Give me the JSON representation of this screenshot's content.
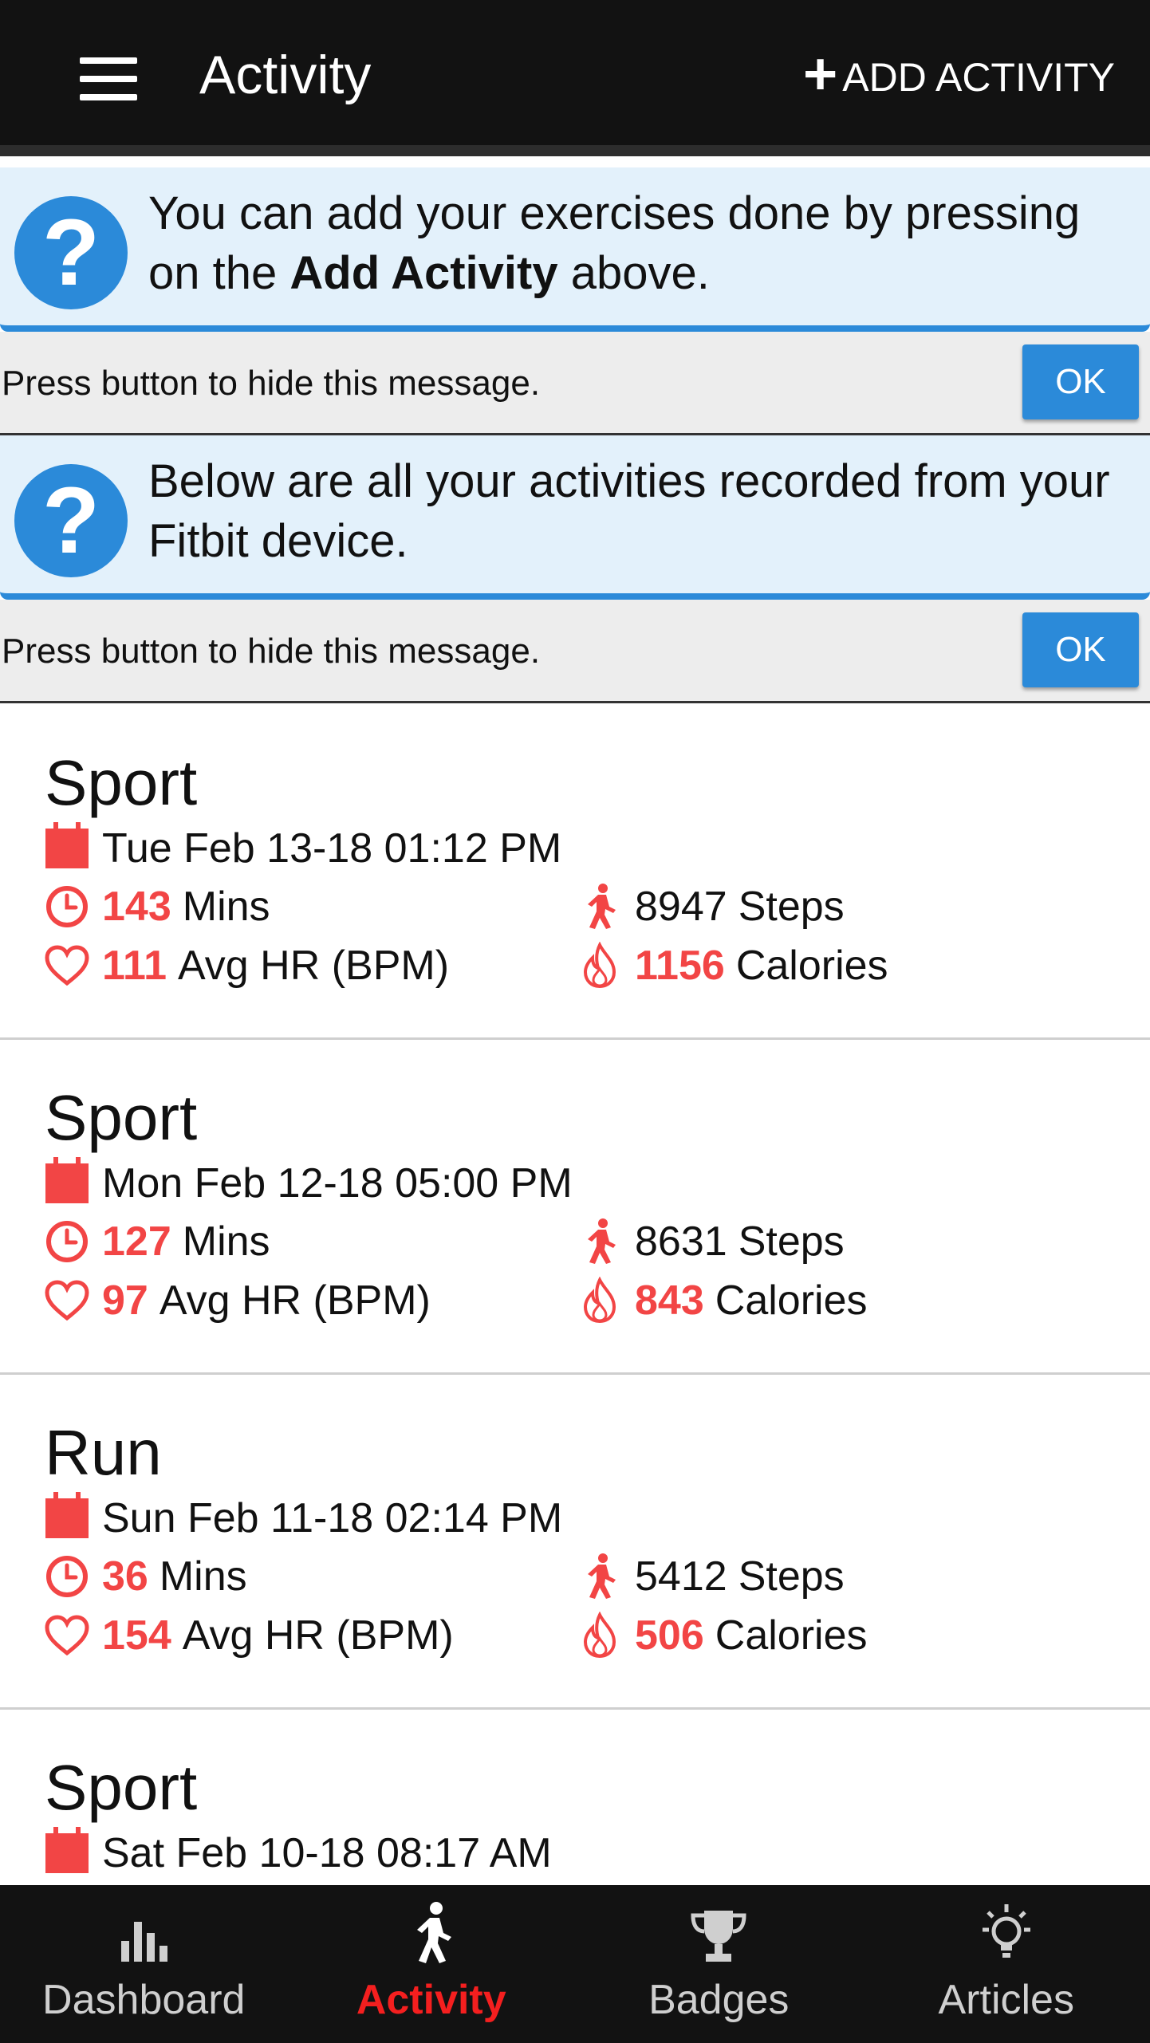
{
  "header": {
    "title": "Activity",
    "add_label": "ADD ACTIVITY",
    "add_icon": "plus-icon",
    "menu_icon": "hamburger-menu-icon"
  },
  "notices": [
    {
      "text_before": "You can add your exercises done by pressing on the ",
      "text_bold": "Add Activity",
      "text_after": " above.",
      "hint": "Press button to hide this message.",
      "button": "OK"
    },
    {
      "text_before": "Below are all your activities recorded from your Fitbit device.",
      "text_bold": "",
      "text_after": "",
      "hint": "Press button to hide this message.",
      "button": "OK"
    }
  ],
  "labels": {
    "mins": "Mins",
    "hr": "Avg HR (BPM)",
    "steps": "Steps",
    "calories": "Calories"
  },
  "activities": [
    {
      "name": "Sport",
      "date": "Tue Feb 13-18 01:12 PM",
      "mins": "143",
      "steps": "8947",
      "hr": "111",
      "calories": "1156"
    },
    {
      "name": "Sport",
      "date": "Mon Feb 12-18 05:00 PM",
      "mins": "127",
      "steps": "8631",
      "hr": "97",
      "calories": "843"
    },
    {
      "name": "Run",
      "date": "Sun Feb 11-18 02:14 PM",
      "mins": "36",
      "steps": "5412",
      "hr": "154",
      "calories": "506"
    },
    {
      "name": "Sport",
      "date": "Sat Feb 10-18 08:17 AM",
      "mins": "",
      "steps": "",
      "hr": "",
      "calories": ""
    }
  ],
  "bottom_nav": [
    {
      "label": "Dashboard",
      "icon": "bar-chart-icon",
      "active": false
    },
    {
      "label": "Activity",
      "icon": "walking-person-icon",
      "active": true
    },
    {
      "label": "Badges",
      "icon": "trophy-icon",
      "active": false
    },
    {
      "label": "Articles",
      "icon": "lightbulb-icon",
      "active": false
    }
  ],
  "colors": {
    "accent_red": "#f24545",
    "info_blue": "#2b8ad9",
    "nav_active": "#f41f1f",
    "app_bar": "#121212"
  }
}
